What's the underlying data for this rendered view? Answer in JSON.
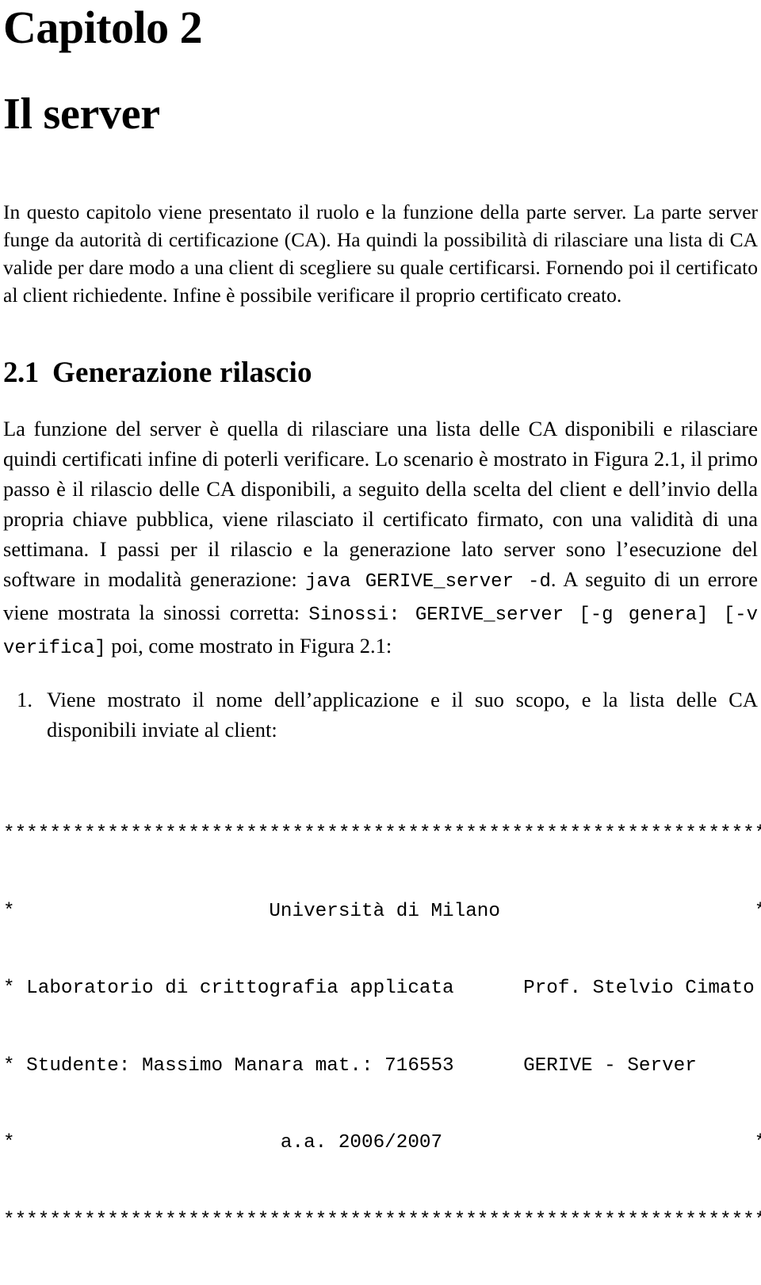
{
  "chapter": {
    "label": "Capitolo 2",
    "title": "Il server"
  },
  "intro": {
    "text": "In questo capitolo viene presentato il ruolo e la funzione della parte server. La parte server funge da autorità di certificazione (CA). Ha quindi la possibilità di rilasciare una lista di CA valide per dare modo a una client di scegliere su quale certificarsi. Fornendo poi il certificato al client richiedente. Infine è possibile verificare il proprio certificato creato."
  },
  "section": {
    "number": "2.1",
    "title": "Generazione rilascio"
  },
  "paragraph": {
    "part1": "La funzione del server è quella di rilasciare una lista delle CA disponibili e rilasciare quindi certificati infine di poterli verificare. Lo scenario è mostrato in Figura 2.1, il primo passo è il rilascio delle CA disponibili, a seguito della scelta del client e dell’invio della propria chiave pubblica, viene rilasciato il certificato firmato, con una validità di una settimana. I passi per il rilascio e la generazione lato server sono l’esecuzione del software in modalità generazione: ",
    "command": "java GERIVE_server -d",
    "part2": ". A seguito di un errore viene mostrata la sinossi corretta: ",
    "synopsis": "Sinossi: GERIVE_server [-g genera] [-v verifica]",
    "part3": " poi, come mostrato in Figura 2.1:"
  },
  "list": {
    "items": [
      {
        "marker": "1.",
        "text": "Viene mostrato il nome dell’applicazione e il suo scopo, e la lista delle CA disponibili inviate al client:"
      }
    ]
  },
  "terminal": {
    "lines": [
      "******************************************************************",
      "*                      Università di Milano                      *",
      "* Laboratorio di crittografia applicata      Prof. Stelvio Cimato *",
      "* Studente: Massimo Manara mat.: 716553      GERIVE - Server      *",
      "*                       a.a. 2006/2007                           *",
      "******************************************************************"
    ],
    "line_0": "******************************************************************",
    "line_1": "*                      Università di Milano                      *",
    "line_2": "* Laboratorio di crittografia applicata      Prof. Stelvio Cimato *",
    "line_3": "* Studente: Massimo Manara mat.: 716553      GERIVE - Server      *",
    "line_4": "*                       a.a. 2006/2007                           *",
    "line_5": "******************************************************************"
  }
}
